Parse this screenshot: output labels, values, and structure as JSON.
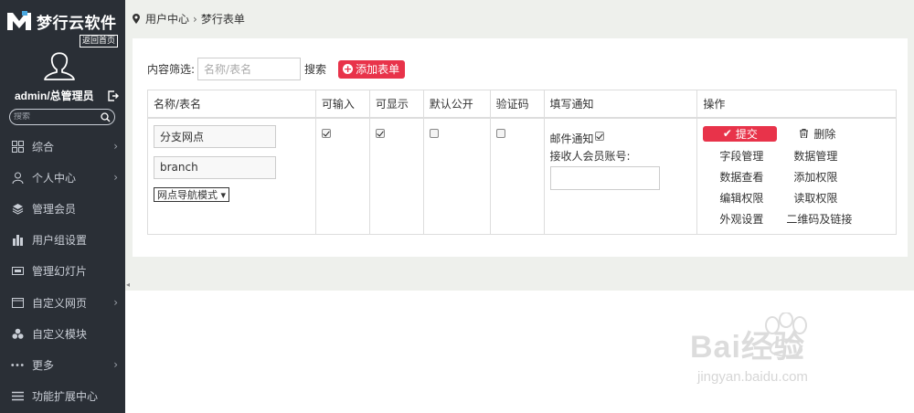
{
  "app": {
    "logo_text": "梦行云软件",
    "home_link": "返回首页"
  },
  "user": {
    "name": "admin/总管理员"
  },
  "sidebar": {
    "search_placeholder": "搜索",
    "items": [
      {
        "label": "综合",
        "icon": "grid-icon",
        "has_submenu": true
      },
      {
        "label": "个人中心",
        "icon": "user-icon",
        "has_submenu": true
      },
      {
        "label": "管理会员",
        "icon": "layers-icon",
        "has_submenu": false
      },
      {
        "label": "用户组设置",
        "icon": "buildings-icon",
        "has_submenu": false
      },
      {
        "label": "管理幻灯片",
        "icon": "slides-icon",
        "has_submenu": false
      },
      {
        "label": "自定义网页",
        "icon": "webpage-icon",
        "has_submenu": true
      },
      {
        "label": "自定义模块",
        "icon": "cubes-icon",
        "has_submenu": false
      },
      {
        "label": "更多",
        "icon": "dots-icon",
        "has_submenu": true
      },
      {
        "label": "功能扩展中心",
        "icon": "menu-lines-icon",
        "has_submenu": false
      }
    ]
  },
  "breadcrumb": {
    "root": "用户中心",
    "separator": "›",
    "current": "梦行表单"
  },
  "filter": {
    "label": "内容筛选:",
    "placeholder": "名称/表名",
    "search_label": "搜索",
    "add_label": "添加表单"
  },
  "table": {
    "headers": [
      "名称/表名",
      "可输入",
      "可显示",
      "默认公开",
      "验证码",
      "填写通知",
      "操作"
    ],
    "row": {
      "name": "分支网点",
      "table_name": "branch",
      "mode": "网点导航模式 ▾",
      "inputable": true,
      "displayable": true,
      "public_default": false,
      "captcha": false,
      "notify_label": "邮件通知",
      "notify_checked": true,
      "receiver_label": "接收人会员账号:",
      "receiver_value": ""
    },
    "actions": {
      "submit": "提交",
      "delete": "删除",
      "links": [
        "字段管理",
        "数据管理",
        "数据查看",
        "添加权限",
        "编辑权限",
        "读取权限",
        "外观设置",
        "二维码及链接"
      ]
    }
  },
  "colors": {
    "sidebar_bg": "#2a2f36",
    "accent": "#e8334a",
    "content_bg": "#eef0ec"
  },
  "watermark": {
    "text": "Bai经验",
    "subtext": "jingyan.baidu.com"
  }
}
